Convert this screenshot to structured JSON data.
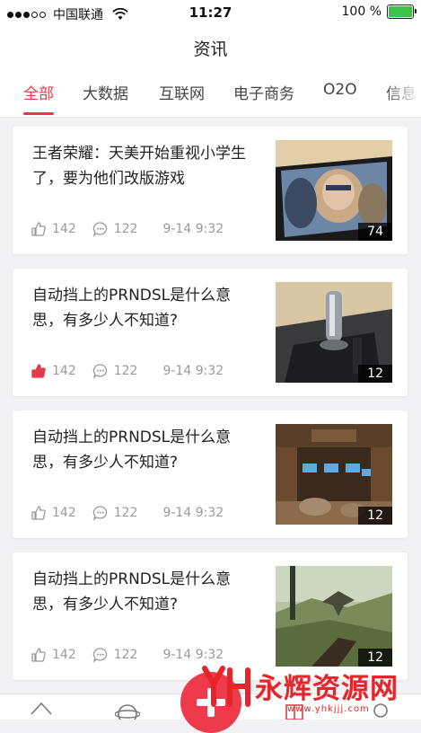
{
  "status_bar": {
    "carrier": "中国联通",
    "time": "11:27",
    "battery_percent": "100 %",
    "battery_level": 1.0,
    "signal_bars_filled": 3,
    "signal_bars_total": 5
  },
  "header": {
    "title": "资讯"
  },
  "tabs": [
    {
      "label": "全部",
      "active": true
    },
    {
      "label": "大数据",
      "active": false
    },
    {
      "label": "互联网",
      "active": false
    },
    {
      "label": "电子商务",
      "active": false
    },
    {
      "label": "O2O",
      "active": false
    },
    {
      "label": "信息",
      "active": false
    }
  ],
  "articles": [
    {
      "title": "王者荣耀：天美开始重视小学生了，要为他们改版游戏",
      "likes": "142",
      "comments": "122",
      "time": "9-14 9:32",
      "image_count": "74",
      "liked": false,
      "image": "game-screenshot"
    },
    {
      "title": "自动挡上的PRNDSL是什么意思，有多少人不知道?",
      "likes": "142",
      "comments": "122",
      "time": "9-14 9:32",
      "image_count": "12",
      "liked": true,
      "image": "gear-shifter"
    },
    {
      "title": "自动挡上的PRNDSL是什么意思，有多少人不知道?",
      "likes": "142",
      "comments": "122",
      "time": "9-14 9:32",
      "image_count": "12",
      "liked": false,
      "image": "office-interior"
    },
    {
      "title": "自动挡上的PRNDSL是什么意思，有多少人不知道?",
      "likes": "142",
      "comments": "122",
      "time": "9-14 9:32",
      "image_count": "12",
      "liked": false,
      "image": "game-landscape"
    }
  ],
  "watermark": {
    "text": "永辉资源网",
    "url": "www.yhkjjj.com"
  },
  "colors": {
    "accent": "#e5394a",
    "liked": "#e5394a",
    "meta": "#9a9a9a"
  }
}
